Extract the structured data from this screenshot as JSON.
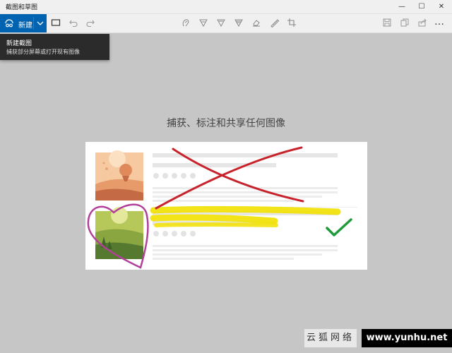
{
  "window": {
    "title": "截图和草图",
    "minimize_symbol": "—",
    "maximize_symbol": "☐",
    "close_symbol": "✕"
  },
  "toolbar": {
    "new_label": "新建",
    "more_symbol": "…",
    "accent_color": "#0063b1"
  },
  "tooltip": {
    "title": "新建截图",
    "description": "捕获部分屏幕或打开现有图像"
  },
  "main": {
    "headline": "捕获、标注和共享任何图像"
  },
  "watermark": {
    "site_name": "云狐网络",
    "url": "www.yunhu.net"
  }
}
